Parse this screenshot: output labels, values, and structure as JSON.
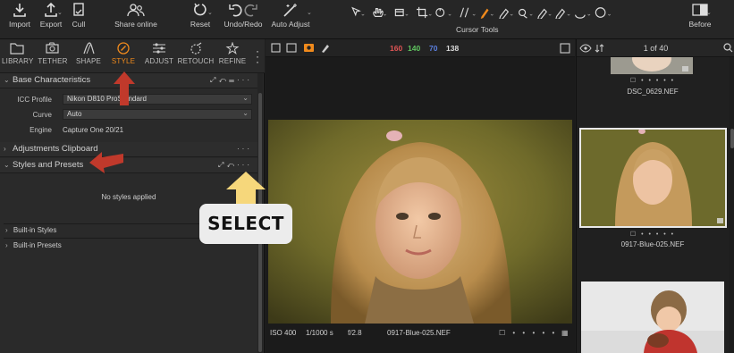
{
  "toolbar": {
    "import": "Import",
    "export": "Export",
    "cull": "Cull",
    "share_online": "Share online",
    "reset": "Reset",
    "undo_redo": "Undo/Redo",
    "auto_adjust": "Auto Adjust",
    "cursor_tools": "Cursor Tools",
    "before": "Before"
  },
  "tabs": [
    {
      "label": "LIBRARY",
      "icon": "folder-icon"
    },
    {
      "label": "TETHER",
      "icon": "camera-tether-icon"
    },
    {
      "label": "SHAPE",
      "icon": "shape-icon"
    },
    {
      "label": "STYLE",
      "icon": "style-icon",
      "active": true
    },
    {
      "label": "ADJUST",
      "icon": "sliders-icon"
    },
    {
      "label": "RETOUCH",
      "icon": "retouch-icon"
    },
    {
      "label": "REFINE",
      "icon": "refine-icon"
    }
  ],
  "base_characteristics": {
    "title": "Base Characteristics",
    "icc_profile_label": "ICC Profile",
    "icc_profile_value": "Nikon D810 ProStandard",
    "curve_label": "Curve",
    "curve_value": "Auto",
    "engine_label": "Engine",
    "engine_value": "Capture One 20/21"
  },
  "adjustments_clipboard": {
    "title": "Adjustments Clipboard"
  },
  "styles_presets": {
    "title": "Styles and Presets",
    "empty_text": "No styles applied",
    "built_in_styles": "Built-in Styles",
    "built_in_presets": "Built-in Presets"
  },
  "viewer": {
    "rgb_r": "160",
    "rgb_g": "140",
    "rgb_b": "70",
    "rgb_l": "138",
    "iso": "ISO 400",
    "shutter": "1/1000 s",
    "aperture": "f/2.8",
    "filename": "0917-Blue-025.NEF"
  },
  "browser": {
    "count": "1 of 40",
    "thumb1_name": "DSC_0629.NEF",
    "thumb2_name": "0917-Blue-025.NEF"
  },
  "annotation": {
    "select_label": "SELECT"
  },
  "colors": {
    "accent_orange": "#f08a1c",
    "arrow_red": "#c0392b",
    "arrow_yellow": "#f6d77b",
    "r": "#e05555",
    "g": "#5fc55f",
    "b": "#5b7fe0"
  }
}
